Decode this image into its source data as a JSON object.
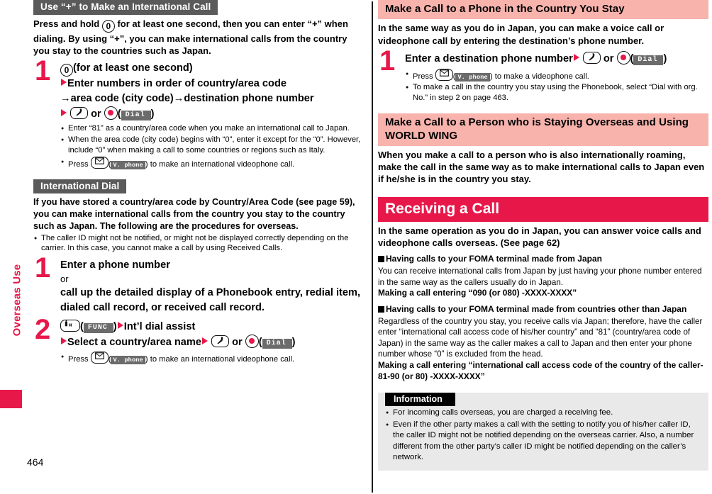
{
  "page": {
    "number": "464",
    "side_tab_label": "Overseas Use"
  },
  "left_column": {
    "section1": {
      "header": "Use “+” to Make an International Call",
      "lead": "Press and hold       for at least one second, then you can enter “+” when dialing. By using “+”, you can make international calls from the country you stay to the countries such as Japan.",
      "lead_before_key": "Press and hold",
      "lead_after_key": "for at least one second, then you can enter “+” when dialing. By using “+”, you can make international calls from the country you stay to the countries such as Japan.",
      "step": {
        "number": "1",
        "line1_after_key": "(for at least one second)",
        "line2": "Enter numbers in order of country/area code",
        "line3": "→area code (city code)→destination phone number",
        "line4_or": "or",
        "dial_softkey": "Dial",
        "notes": [
          "Enter “81” as a country/area code when you make an international call to Japan.",
          "When the area code (city code) begins with “0”, enter it except for the “0”. However, include “0” when making a call to some countries or regions such as Italy.",
          "Press"
        ],
        "note3_after": "to make an international videophone call.",
        "vphone_softkey": "V. phone"
      }
    },
    "section2": {
      "header": "International Dial",
      "lead": "If you have stored a country/area code by Country/Area Code (see page 59), you can make international calls from the country you stay to the country such as Japan. The following are the procedures for overseas.",
      "note": "The caller ID might not be notified, or might not be displayed correctly depending on the carrier. In this case, you cannot make a call by using Received Calls.",
      "step1": {
        "number": "1",
        "line1": "Enter a phone number",
        "line2": "or",
        "line3": "call up the detailed display of a Phonebook entry, redial item, dialed call record, or received call record."
      },
      "step2": {
        "number": "2",
        "func_softkey": "FUNC",
        "line1_after": "Int’l dial assist",
        "line2": "Select a country/area name",
        "line2_or": "or",
        "dial_softkey": "Dial",
        "note_before": "Press",
        "note_after": "to make an international videophone call.",
        "vphone_softkey": "V. phone"
      }
    }
  },
  "right_column": {
    "section3": {
      "header": "Make a Call to a Phone in the Country You Stay",
      "lead": "In the same way as you do in Japan, you can make a voice call or videophone call by entering the destination’s phone number.",
      "step": {
        "number": "1",
        "line1": "Enter a destination phone number",
        "line1_or": "or",
        "dial_softkey": "Dial",
        "note1_before": "Press",
        "note1_after": "to make a videophone call.",
        "vphone_softkey": "V. phone",
        "note2": "To make a call in the country you stay using the Phonebook, select “Dial with org. No.” in step 2 on page 463."
      }
    },
    "section4": {
      "header": "Make a Call to a Person who is Staying Overseas and Using WORLD WING",
      "lead": "When you make a call to a person who is also internationally roaming, make the call in the same way as to make international calls to Japan even if he/she is in the country you stay."
    },
    "section5": {
      "header": "Receiving a Call",
      "lead": "In the same operation as you do in Japan, you can answer voice calls and videophone calls overseas. (See page 62)",
      "sub1": {
        "heading": "Having calls to your FOMA terminal made from Japan",
        "body": "You can receive international calls from Japan by just having your phone number entered in the same way as the callers usually do in Japan.",
        "bold": "Making a call entering “090 (or 080) -XXXX-XXXX”"
      },
      "sub2": {
        "heading": "Having calls to your FOMA terminal made from countries other than Japan",
        "body": "Regardless of the country you stay, you receive calls via Japan; therefore, have the caller enter “international call access code of his/her country” and “81” (country/area code of Japan) in the same way as the caller makes a call to Japan and then enter your phone number whose “0” is excluded from the head.",
        "bold": "Making a call entering “international call access code of the country of the caller-81-90 (or 80) -XXXX-XXXX”"
      },
      "information": {
        "title": "Information",
        "items": [
          "For incoming calls overseas, you are charged a receiving fee.",
          "Even if the other party makes a call with the setting to notify you of his/her caller ID, the caller ID might not be notified depending on the overseas carrier. Also, a number different from the other party’s caller ID might be notified depending on the caller’s network."
        ]
      }
    }
  },
  "icons": {
    "zero_key": "0",
    "call_key": "call-handset",
    "center_key": "center-select",
    "mail_key": "mail-envelope",
    "imode_key": "imode-alpha"
  },
  "colors": {
    "accent_red": "#e8174a",
    "header_gray": "#5a5a5a",
    "header_pink": "#f8b3ad",
    "softkey_gray": "#6b6b6b",
    "info_bg": "#e9e9e9"
  }
}
